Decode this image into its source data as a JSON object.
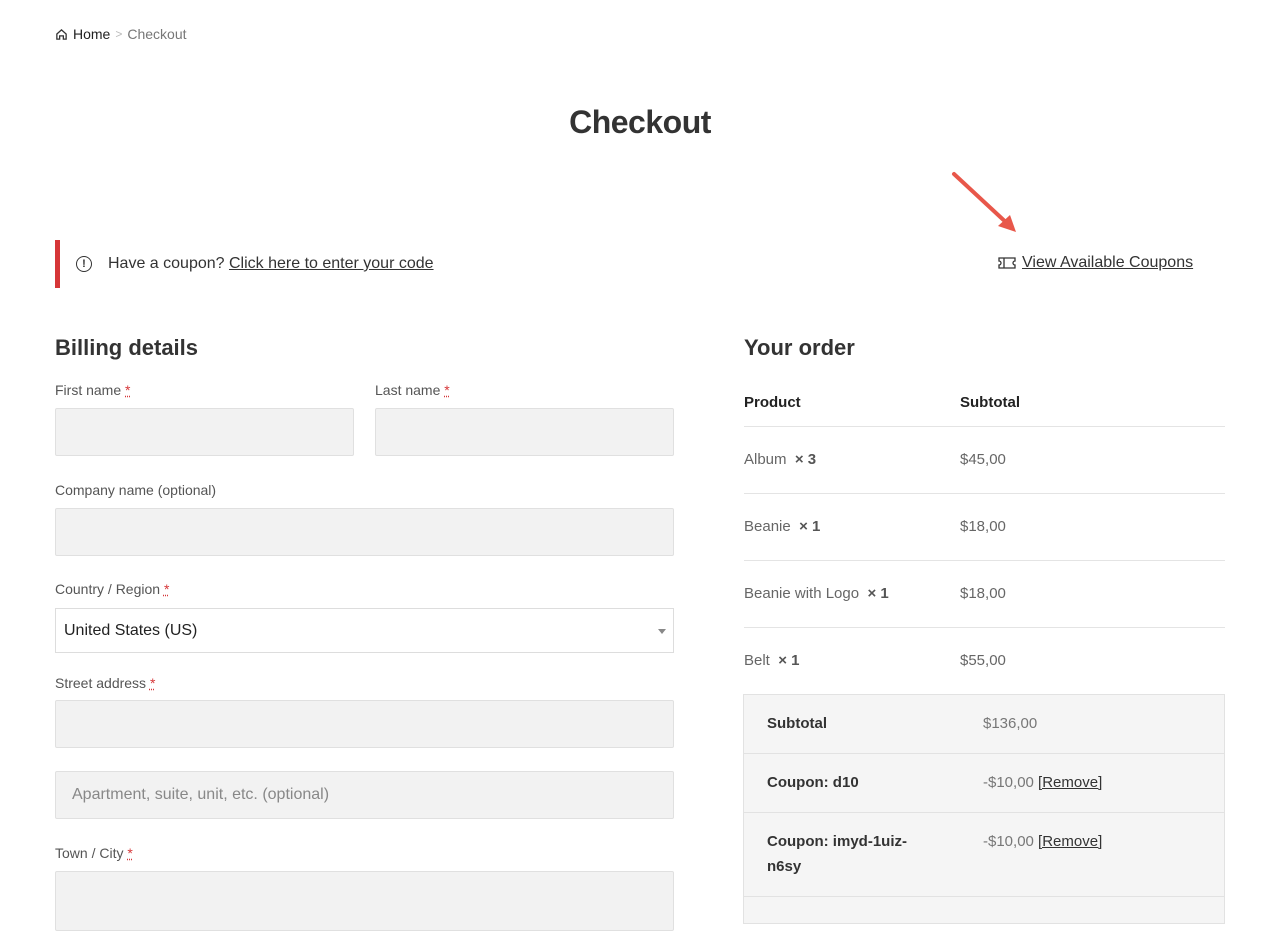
{
  "breadcrumb": {
    "home": "Home",
    "separator": ">",
    "current": "Checkout"
  },
  "page_title": "Checkout",
  "notice": {
    "text": "Have a coupon?",
    "link": "Click here to enter your code"
  },
  "view_coupons": "View Available Coupons",
  "billing": {
    "title": "Billing details",
    "first_name": "First name",
    "last_name": "Last name",
    "company": "Company name (optional)",
    "country": "Country / Region",
    "country_value": "United States (US)",
    "street": "Street address",
    "apartment_placeholder": "Apartment, suite, unit, etc. (optional)",
    "town": "Town / City",
    "required": "*"
  },
  "order": {
    "title": "Your order",
    "col_product": "Product",
    "col_subtotal": "Subtotal",
    "items": [
      {
        "name": "Album",
        "qty": "× 3",
        "subtotal": "$45,00"
      },
      {
        "name": "Beanie",
        "qty": "× 1",
        "subtotal": "$18,00"
      },
      {
        "name": "Beanie with Logo",
        "qty": "× 1",
        "subtotal": "$18,00"
      },
      {
        "name": "Belt",
        "qty": "× 1",
        "subtotal": "$55,00"
      }
    ],
    "subtotal_label": "Subtotal",
    "subtotal_value": "$136,00",
    "coupons": [
      {
        "label": "Coupon: d10",
        "value": "-$10,00",
        "remove": "[Remove]"
      },
      {
        "label": "Coupon: imyd-1uiz-n6sy",
        "value": "-$10,00",
        "remove": "[Remove]"
      }
    ]
  }
}
